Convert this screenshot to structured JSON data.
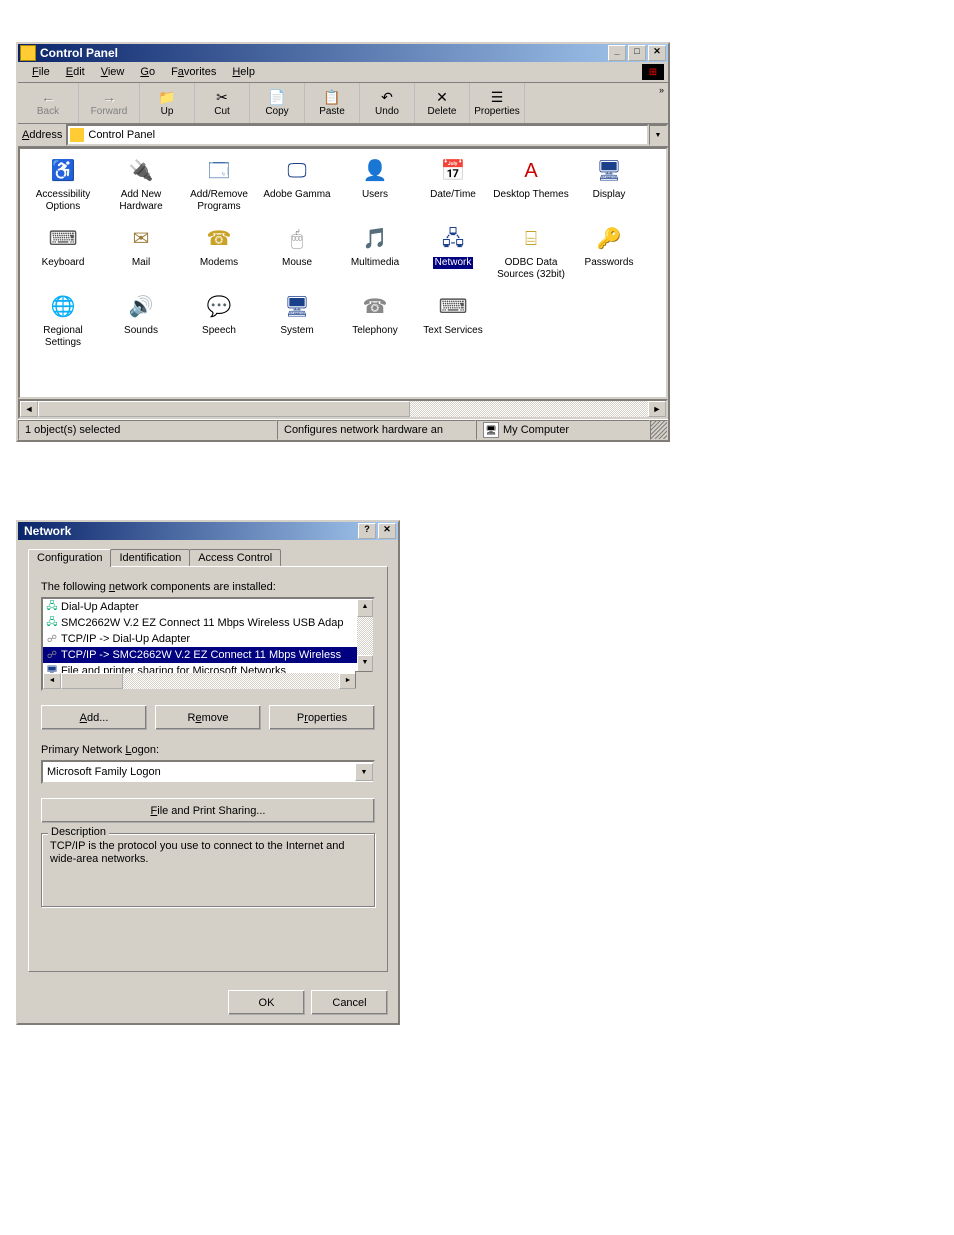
{
  "cp": {
    "title": "Control Panel",
    "menus": [
      "File",
      "Edit",
      "View",
      "Go",
      "Favorites",
      "Help"
    ],
    "toolbar": [
      {
        "label": "Back",
        "glyph": "←",
        "disabled": true
      },
      {
        "label": "Forward",
        "glyph": "→",
        "disabled": true
      },
      {
        "label": "Up",
        "glyph": "📁"
      },
      {
        "label": "Cut",
        "glyph": "✂"
      },
      {
        "label": "Copy",
        "glyph": "📄"
      },
      {
        "label": "Paste",
        "glyph": "📋"
      },
      {
        "label": "Undo",
        "glyph": "↶"
      },
      {
        "label": "Delete",
        "glyph": "✕"
      },
      {
        "label": "Properties",
        "glyph": "☰"
      }
    ],
    "address": {
      "label": "Address",
      "value": "Control Panel"
    },
    "icons": [
      {
        "label": "Accessibility Options",
        "glyph": "♿",
        "c": "#0066cc"
      },
      {
        "label": "Add New Hardware",
        "glyph": "🔌",
        "c": "#5aa02c"
      },
      {
        "label": "Add/Remove Programs",
        "glyph": "🗔",
        "c": "#3a6ea5"
      },
      {
        "label": "Adobe Gamma",
        "glyph": "🖵",
        "c": "#1a3f8b"
      },
      {
        "label": "Users",
        "glyph": "👤",
        "c": "#000"
      },
      {
        "label": "Date/Time",
        "glyph": "📅",
        "c": "#d01"
      },
      {
        "label": "Desktop Themes",
        "glyph": "A",
        "c": "#c00"
      },
      {
        "label": "Display",
        "glyph": "🖥",
        "c": "#1a3f8b"
      },
      {
        "label": "Keyboard",
        "glyph": "⌨",
        "c": "#555"
      },
      {
        "label": "Mail",
        "glyph": "✉",
        "c": "#9a7b3a"
      },
      {
        "label": "Modems",
        "glyph": "☎",
        "c": "#c9a227"
      },
      {
        "label": "Mouse",
        "glyph": "🖱",
        "c": "#888"
      },
      {
        "label": "Multimedia",
        "glyph": "🎵",
        "c": "#7a5"
      },
      {
        "label": "Network",
        "glyph": "🖧",
        "c": "#1a3f8b",
        "selected": true
      },
      {
        "label": "ODBC Data Sources (32bit)",
        "glyph": "⌸",
        "c": "#c9a227"
      },
      {
        "label": "Passwords",
        "glyph": "🔑",
        "c": "#c9a227"
      },
      {
        "label": "Regional Settings",
        "glyph": "🌐",
        "c": "#0a7"
      },
      {
        "label": "Sounds",
        "glyph": "🔊",
        "c": "#c9a227"
      },
      {
        "label": "Speech",
        "glyph": "💬",
        "c": "#888"
      },
      {
        "label": "System",
        "glyph": "🖥",
        "c": "#1a3f8b"
      },
      {
        "label": "Telephony",
        "glyph": "☎",
        "c": "#888"
      },
      {
        "label": "Text Services",
        "glyph": "⌨",
        "c": "#555"
      }
    ],
    "status": {
      "left": "1 object(s) selected",
      "mid": "Configures network hardware an",
      "right": "My Computer"
    }
  },
  "net": {
    "title": "Network",
    "tabs": [
      "Configuration",
      "Identification",
      "Access Control"
    ],
    "list_label": "The following network components are installed:",
    "components": [
      {
        "text": "Dial-Up Adapter",
        "icon": "🖧",
        "c": "#0a7"
      },
      {
        "text": "SMC2662W V.2 EZ Connect 11 Mbps Wireless USB Adap",
        "icon": "🖧",
        "c": "#0a7"
      },
      {
        "text": "TCP/IP -> Dial-Up Adapter",
        "icon": "☍",
        "c": "#888"
      },
      {
        "text": "TCP/IP -> SMC2662W V.2 EZ Connect 11 Mbps Wireless",
        "icon": "☍",
        "c": "#888",
        "selected": true
      },
      {
        "text": "File and printer sharing for Microsoft Networks",
        "icon": "🖥",
        "c": "#1a3f8b"
      }
    ],
    "buttons": {
      "add": "Add...",
      "remove": "Remove",
      "properties": "Properties"
    },
    "logon_label": "Primary Network Logon:",
    "logon_value": "Microsoft Family Logon",
    "fps_button": "File and Print Sharing...",
    "desc_label": "Description",
    "desc_text": "TCP/IP is the protocol you use to connect to the Internet and wide-area networks.",
    "ok": "OK",
    "cancel": "Cancel"
  }
}
